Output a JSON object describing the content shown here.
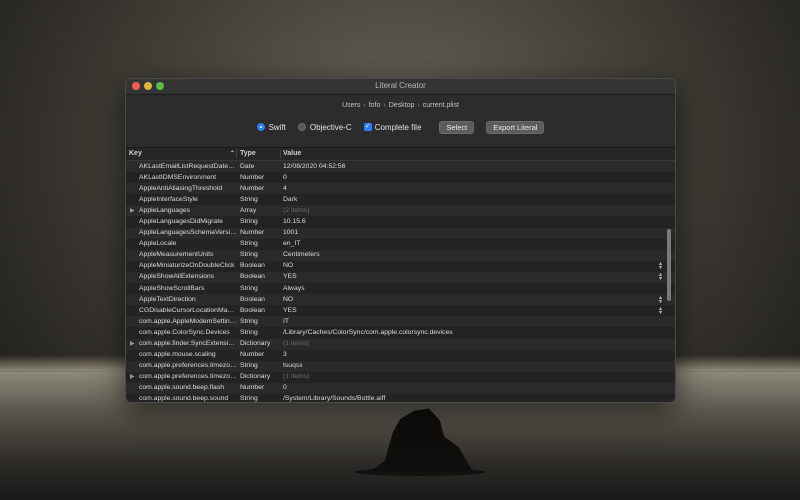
{
  "window": {
    "title": "Literal Creator"
  },
  "breadcrumb": [
    "Users",
    "fofo",
    "Desktop",
    "current.plist"
  ],
  "options": {
    "swift_label": "Swift",
    "objc_label": "Objective-C",
    "complete_file_label": "Complete file",
    "select_button": "Select",
    "export_button": "Export Literal"
  },
  "table": {
    "headers": {
      "key": "Key",
      "type": "Type",
      "value": "Value"
    },
    "rows": [
      {
        "key": "AKLastEmailListRequestDateKey",
        "type": "Date",
        "value": "12/08/2020  04:52:56",
        "expandable": false,
        "dim": false,
        "stepper": false
      },
      {
        "key": "AKLastIDMSEnvironment",
        "type": "Number",
        "value": "0",
        "expandable": false,
        "dim": false,
        "stepper": false
      },
      {
        "key": "AppleAntiAliasingThreshold",
        "type": "Number",
        "value": "4",
        "expandable": false,
        "dim": false,
        "stepper": false
      },
      {
        "key": "AppleInterfaceStyle",
        "type": "String",
        "value": "Dark",
        "expandable": false,
        "dim": false,
        "stepper": false
      },
      {
        "key": "AppleLanguages",
        "type": "Array",
        "value": "(2 items)",
        "expandable": true,
        "dim": true,
        "stepper": false
      },
      {
        "key": "AppleLanguagesDidMigrate",
        "type": "String",
        "value": "10.15.6",
        "expandable": false,
        "dim": false,
        "stepper": false
      },
      {
        "key": "AppleLanguagesSchemaVersion",
        "type": "Number",
        "value": "1001",
        "expandable": false,
        "dim": false,
        "stepper": false
      },
      {
        "key": "AppleLocale",
        "type": "String",
        "value": "en_IT",
        "expandable": false,
        "dim": false,
        "stepper": false
      },
      {
        "key": "AppleMeasurementUnits",
        "type": "String",
        "value": "Centimeters",
        "expandable": false,
        "dim": false,
        "stepper": false
      },
      {
        "key": "AppleMiniaturizeOnDoubleClick",
        "type": "Boolean",
        "value": "NO",
        "expandable": false,
        "dim": false,
        "stepper": true
      },
      {
        "key": "AppleShowAllExtensions",
        "type": "Boolean",
        "value": "YES",
        "expandable": false,
        "dim": false,
        "stepper": true
      },
      {
        "key": "AppleShowScrollBars",
        "type": "String",
        "value": "Always",
        "expandable": false,
        "dim": false,
        "stepper": false
      },
      {
        "key": "AppleTextDirection",
        "type": "Boolean",
        "value": "NO",
        "expandable": false,
        "dim": false,
        "stepper": true
      },
      {
        "key": "CGDisableCursorLocationMagni...",
        "type": "Boolean",
        "value": "YES",
        "expandable": false,
        "dim": false,
        "stepper": true
      },
      {
        "key": "com.apple.AppleModemSetting...",
        "type": "String",
        "value": "IT",
        "expandable": false,
        "dim": false,
        "stepper": false
      },
      {
        "key": "com.apple.ColorSync.Devices",
        "type": "String",
        "value": "/Library/Caches/ColorSync/com.apple.colorsync.devices",
        "expandable": false,
        "dim": false,
        "stepper": false
      },
      {
        "key": "com.apple.finder.SyncExtensions",
        "type": "Dictionary",
        "value": "(1 items)",
        "expandable": true,
        "dim": true,
        "stepper": false
      },
      {
        "key": "com.apple.mouse.scaling",
        "type": "Number",
        "value": "3",
        "expandable": false,
        "dim": false,
        "stepper": false
      },
      {
        "key": "com.apple.preferences.timezon...",
        "type": "String",
        "value": "tsuqsx",
        "expandable": false,
        "dim": false,
        "stepper": false
      },
      {
        "key": "com.apple.preferences.timezon...",
        "type": "Dictionary",
        "value": "(1 items)",
        "expandable": true,
        "dim": true,
        "stepper": false
      },
      {
        "key": "com.apple.sound.beep.flash",
        "type": "Number",
        "value": "0",
        "expandable": false,
        "dim": false,
        "stepper": false
      },
      {
        "key": "com.apple.sound.beep.sound",
        "type": "String",
        "value": "/System/Library/Sounds/Bottle.aiff",
        "expandable": false,
        "dim": false,
        "stepper": false
      }
    ]
  }
}
